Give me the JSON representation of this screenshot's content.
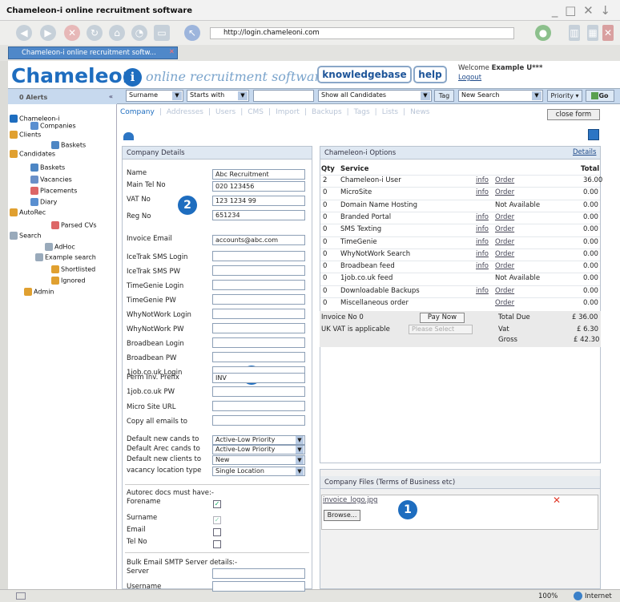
{
  "window": {
    "title": "Chameleon-i online recruitment software"
  },
  "browser": {
    "url": "http://login.chameleoni.com",
    "tab_label": "Chameleon-i online recruitment softw...",
    "zoom": "100%",
    "zone": "Internet"
  },
  "header": {
    "logo": "Chameleon",
    "logo_mark": "i",
    "tagline": "online recruitment software",
    "knowledgebase": "knowledgebase",
    "help": "help",
    "welcome_prefix": "Welcome ",
    "welcome_user": "Example U***",
    "logout": "Logout"
  },
  "toolbar": {
    "alerts": "0 Alerts",
    "field": "Surname",
    "operator": "Starts with",
    "search_value": "",
    "filter": "Show all Candidates",
    "tag": "Tag",
    "new_search": "New Search",
    "priority": "Priority",
    "go": "Go"
  },
  "sidebar": {
    "items": [
      {
        "label": "Chameleon-i"
      },
      {
        "label": "Companies"
      },
      {
        "label": "Clients"
      },
      {
        "label": "Baskets"
      },
      {
        "label": "Candidates"
      },
      {
        "label": "Baskets"
      },
      {
        "label": "Vacancies"
      },
      {
        "label": "Placements"
      },
      {
        "label": "Diary"
      },
      {
        "label": "AutoRec"
      },
      {
        "label": "Parsed CVs"
      },
      {
        "label": "Search"
      },
      {
        "label": "AdHoc"
      },
      {
        "label": "Example search"
      },
      {
        "label": "Shortlisted"
      },
      {
        "label": "Ignored"
      },
      {
        "label": "Admin"
      }
    ]
  },
  "subnav": {
    "tabs": [
      "Company",
      "Addresses",
      "Users",
      "CMS",
      "Import",
      "Backups",
      "Tags",
      "Lists",
      "News"
    ],
    "close_form": "close form"
  },
  "company": {
    "heading": "Company Details",
    "fields": [
      {
        "label": "Name",
        "value": "Abc Recruitment"
      },
      {
        "label": "Main Tel No",
        "value": "020 123456"
      },
      {
        "label": "VAT No",
        "value": "123 1234 99"
      },
      {
        "label": "Reg No",
        "value": "651234"
      },
      {
        "label": "Invoice Email",
        "value": "accounts@abc.com"
      },
      {
        "label": "IceTrak SMS Login",
        "value": ""
      },
      {
        "label": "IceTrak SMS PW",
        "value": ""
      },
      {
        "label": "TimeGenie Login",
        "value": ""
      },
      {
        "label": "TimeGenie PW",
        "value": ""
      },
      {
        "label": "WhyNotWork Login",
        "value": ""
      },
      {
        "label": "WhyNotWork PW",
        "value": ""
      },
      {
        "label": "Broadbean Login",
        "value": ""
      },
      {
        "label": "Broadbean PW",
        "value": ""
      },
      {
        "label": "1job.co.uk Login",
        "value": ""
      },
      {
        "label": "Perm Inv. Prefix",
        "value": "INV"
      },
      {
        "label": "1job.co.uk PW",
        "value": ""
      },
      {
        "label": "Micro Site URL",
        "value": ""
      },
      {
        "label": "Copy all emails to",
        "value": ""
      }
    ],
    "defaults": [
      {
        "label": "Default new cands to",
        "value": "Active-Low Priority"
      },
      {
        "label": "Default Arec cands to",
        "value": "Active-Low Priority"
      },
      {
        "label": "Default new clients to",
        "value": "New"
      },
      {
        "label": "vacancy location type",
        "value": "Single Location"
      }
    ],
    "autorec_heading": "Autorec docs must have:-",
    "autorec": [
      {
        "label": "Forename",
        "checked": true
      },
      {
        "label": "Surname",
        "checked": true
      },
      {
        "label": "Email",
        "checked": false
      },
      {
        "label": "Tel No",
        "checked": false
      }
    ],
    "smtp_heading": "Bulk Email SMTP Server details:-",
    "smtp": [
      {
        "label": "Server"
      },
      {
        "label": "Username"
      }
    ]
  },
  "options": {
    "heading": "Chameleon-i Options",
    "details": "Details",
    "col_qty": "Qty",
    "col_service": "Service",
    "col_total": "Total",
    "rows": [
      {
        "qty": "2",
        "service": "Chameleon-i User",
        "info": "info",
        "action": "Order",
        "total": "36.00"
      },
      {
        "qty": "0",
        "service": "MicroSite",
        "info": "info",
        "action": "Order",
        "total": "0.00"
      },
      {
        "qty": "0",
        "service": "Domain Name Hosting",
        "info": "",
        "action": "Not Available",
        "total": "0.00"
      },
      {
        "qty": "0",
        "service": "Branded Portal",
        "info": "info",
        "action": "Order",
        "total": "0.00"
      },
      {
        "qty": "0",
        "service": "SMS Texting",
        "info": "info",
        "action": "Order",
        "total": "0.00"
      },
      {
        "qty": "0",
        "service": "TimeGenie",
        "info": "info",
        "action": "Order",
        "total": "0.00"
      },
      {
        "qty": "0",
        "service": "WhyNotWork Search",
        "info": "info",
        "action": "Order",
        "total": "0.00"
      },
      {
        "qty": "0",
        "service": "Broadbean feed",
        "info": "info",
        "action": "Order",
        "total": "0.00"
      },
      {
        "qty": "0",
        "service": "1job.co.uk feed",
        "info": "",
        "action": "Not Available",
        "total": "0.00"
      },
      {
        "qty": "0",
        "service": "Downloadable Backups",
        "info": "info",
        "action": "Order",
        "total": "0.00"
      },
      {
        "qty": "0",
        "service": "Miscellaneous order",
        "info": "",
        "action": "Order",
        "total": "0.00"
      }
    ],
    "invoice_no": "Invoice No 0",
    "pay_now": "Pay Now",
    "total_due_label": "Total Due",
    "total_due": "£ 36.00",
    "vat_question": "UK VAT is applicable",
    "vat_select": "Please Select",
    "vat_label": "Vat",
    "vat": "£ 6.30",
    "gross_label": "Gross",
    "gross": "£ 42.30"
  },
  "files": {
    "heading": "Company Files (Terms of Business etc)",
    "file": "invoice_logo.jpg",
    "browse": "Browse..."
  },
  "callouts": [
    "1",
    "2",
    "3"
  ],
  "colors": {
    "brand": "#1e6dbf",
    "toolbar": "#c7d9ee"
  }
}
